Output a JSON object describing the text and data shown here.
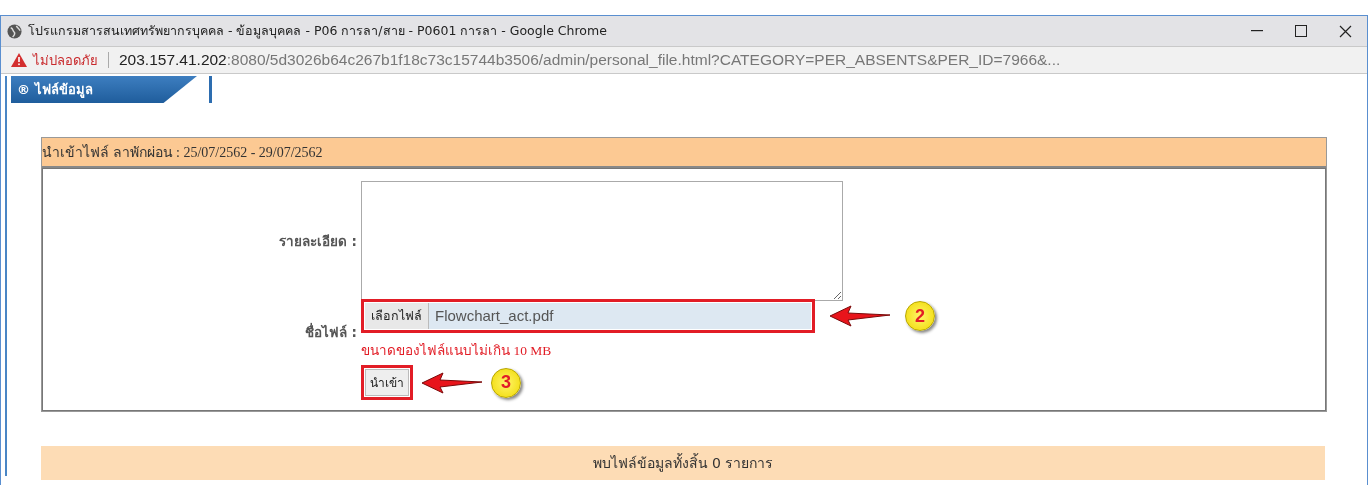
{
  "window": {
    "title": "โปรแกรมสารสนเทศทรัพยากรบุคคล - ข้อมูลบุคคล - P06 การลา/สาย - P0601 การลา - Google Chrome"
  },
  "address_bar": {
    "security": "ไม่ปลอดภัย",
    "host": "203.157.41.202",
    "rest": ":8080/5d3026b64c267b1f18c73c15744b3506/admin/personal_file.html?CATEGORY=PER_ABSENTS&PER_ID=7966&..."
  },
  "tab": {
    "label": "® ไฟล์ข้อมูล"
  },
  "panel": {
    "header": "นำเข้าไฟล์ ลาพักผ่อน : 25/07/2562 - 29/07/2562",
    "detail_label": "รายละเอียด :",
    "file_label": "ชื่อไฟล์ :",
    "choose_button": "เลือกไฟล์",
    "file_name": "Flowchart_act.pdf",
    "hint": "ขนาดของไฟล์แนบไม่เกิน 10 MB",
    "import_button": "นำเข้า"
  },
  "annotations": [
    {
      "number": "2"
    },
    {
      "number": "3"
    }
  ],
  "result": "พบไฟล์ข้อมูลทั้งสิ้น 0 รายการ"
}
